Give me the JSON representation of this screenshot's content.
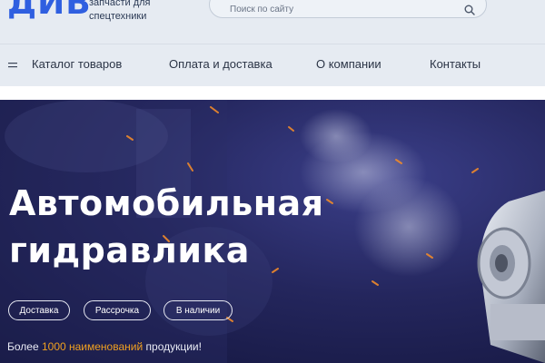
{
  "header": {
    "logo": "ДИВ",
    "tagline_line1": "запчасти для",
    "tagline_line2": "спецтехники"
  },
  "search": {
    "placeholder": "Поиск по сайту",
    "icon": "search-icon"
  },
  "nav": {
    "menu_icon": "menu-icon",
    "items": [
      {
        "label": "Каталог товаров"
      },
      {
        "label": "Оплата и доставка"
      },
      {
        "label": "О компании"
      },
      {
        "label": "Контакты"
      }
    ]
  },
  "hero": {
    "title_line1": "Автомобильная",
    "title_line2": "гидравлика",
    "pills": [
      {
        "label": "Доставка"
      },
      {
        "label": "Рассрочка"
      },
      {
        "label": "В наличии"
      }
    ],
    "bottom_prefix": "Более ",
    "bottom_accent": "1000 наименований",
    "bottom_suffix": " продукции!"
  },
  "colors": {
    "accent": "#2f5fe0",
    "highlight": "#f0a020",
    "hero_dark": "#1a1c4a"
  }
}
